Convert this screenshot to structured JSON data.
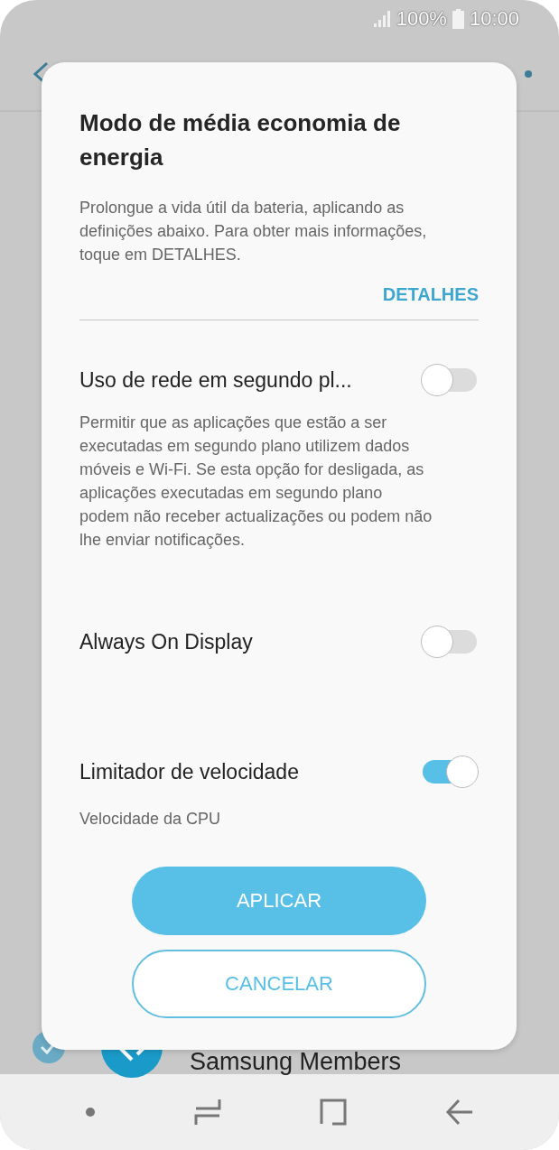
{
  "status_bar": {
    "battery": "100%",
    "time": "10:00"
  },
  "background": {
    "app_name": "Samsung Members"
  },
  "dialog": {
    "title": "Modo de média economia de energia",
    "description": "Prolongue a vida útil da bateria, aplicando as definições abaixo. Para obter mais informações, toque em DETALHES.",
    "details_link": "DETALHES",
    "settings": [
      {
        "label": "Uso de rede em segundo pl...",
        "on": false,
        "description": "Permitir que as aplicações que estão a ser executadas em segundo plano utilizem dados móveis e Wi-Fi. Se esta opção for desligada, as aplicações executadas em segundo plano podem não receber actualizações ou podem não lhe enviar notificações."
      },
      {
        "label": "Always On Display",
        "on": false
      },
      {
        "label": "Limitador de velocidade",
        "on": true,
        "subtitle": "Velocidade da CPU"
      }
    ],
    "buttons": [
      {
        "label": "APLICAR",
        "kind": "primary"
      },
      {
        "label": "CANCELAR",
        "kind": "outline"
      }
    ]
  }
}
